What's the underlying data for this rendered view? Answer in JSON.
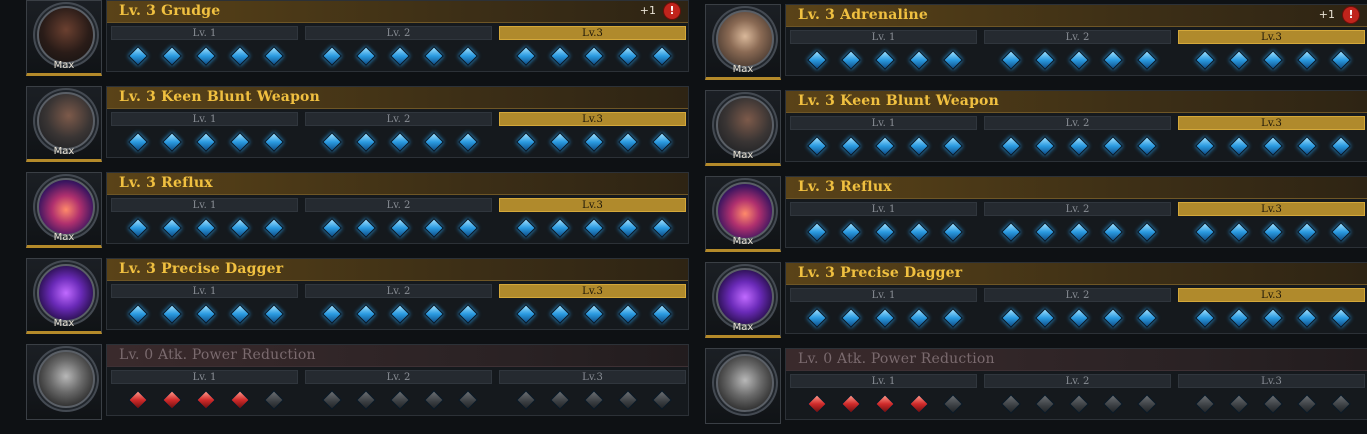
{
  "columns": [
    {
      "engravings": [
        {
          "title": "Lv. 3 Grudge",
          "orb": "grudge",
          "max": "Max",
          "plus": "+1",
          "alert": "!",
          "dim": false,
          "levels": [
            {
              "label": "Lv. 1",
              "active": false,
              "nodes": [
                "blue",
                "blue",
                "blue",
                "blue",
                "blue"
              ]
            },
            {
              "label": "Lv. 2",
              "active": false,
              "nodes": [
                "blue",
                "blue",
                "blue",
                "blue",
                "blue"
              ]
            },
            {
              "label": "Lv.3",
              "active": true,
              "nodes": [
                "blue",
                "blue",
                "blue",
                "blue",
                "blue"
              ]
            }
          ]
        },
        {
          "title": "Lv. 3 Keen Blunt Weapon",
          "orb": "keen",
          "max": "Max",
          "plus": "",
          "alert": "",
          "dim": false,
          "levels": [
            {
              "label": "Lv. 1",
              "active": false,
              "nodes": [
                "blue",
                "blue",
                "blue",
                "blue",
                "blue"
              ]
            },
            {
              "label": "Lv. 2",
              "active": false,
              "nodes": [
                "blue",
                "blue",
                "blue",
                "blue",
                "blue"
              ]
            },
            {
              "label": "Lv.3",
              "active": true,
              "nodes": [
                "blue",
                "blue",
                "blue",
                "blue",
                "blue"
              ]
            }
          ]
        },
        {
          "title": "Lv. 3 Reflux",
          "orb": "reflux",
          "max": "Max",
          "plus": "",
          "alert": "",
          "dim": false,
          "levels": [
            {
              "label": "Lv. 1",
              "active": false,
              "nodes": [
                "blue",
                "blue",
                "blue",
                "blue",
                "blue"
              ]
            },
            {
              "label": "Lv. 2",
              "active": false,
              "nodes": [
                "blue",
                "blue",
                "blue",
                "blue",
                "blue"
              ]
            },
            {
              "label": "Lv.3",
              "active": true,
              "nodes": [
                "blue",
                "blue",
                "blue",
                "blue",
                "blue"
              ]
            }
          ]
        },
        {
          "title": "Lv. 3 Precise Dagger",
          "orb": "dagger",
          "max": "Max",
          "plus": "",
          "alert": "",
          "dim": false,
          "levels": [
            {
              "label": "Lv. 1",
              "active": false,
              "nodes": [
                "blue",
                "blue",
                "blue",
                "blue",
                "blue"
              ]
            },
            {
              "label": "Lv. 2",
              "active": false,
              "nodes": [
                "blue",
                "blue",
                "blue",
                "blue",
                "blue"
              ]
            },
            {
              "label": "Lv.3",
              "active": true,
              "nodes": [
                "blue",
                "blue",
                "blue",
                "blue",
                "blue"
              ]
            }
          ]
        },
        {
          "title": "Lv. 0 Atk. Power Reduction",
          "orb": "atk",
          "max": "",
          "plus": "",
          "alert": "",
          "dim": true,
          "levels": [
            {
              "label": "Lv. 1",
              "active": false,
              "nodes": [
                "red",
                "red",
                "red",
                "red",
                "grey"
              ]
            },
            {
              "label": "Lv. 2",
              "active": false,
              "nodes": [
                "grey",
                "grey",
                "grey",
                "grey",
                "grey"
              ]
            },
            {
              "label": "Lv.3",
              "active": false,
              "nodes": [
                "grey",
                "grey",
                "grey",
                "grey",
                "grey"
              ]
            }
          ]
        }
      ]
    },
    {
      "engravings": [
        {
          "title": "Lv. 3 Adrenaline",
          "orb": "adren",
          "max": "Max",
          "plus": "+1",
          "alert": "!",
          "dim": false,
          "levels": [
            {
              "label": "Lv. 1",
              "active": false,
              "nodes": [
                "blue",
                "blue",
                "blue",
                "blue",
                "blue"
              ]
            },
            {
              "label": "Lv. 2",
              "active": false,
              "nodes": [
                "blue",
                "blue",
                "blue",
                "blue",
                "blue"
              ]
            },
            {
              "label": "Lv.3",
              "active": true,
              "nodes": [
                "blue",
                "blue",
                "blue",
                "blue",
                "blue"
              ]
            }
          ]
        },
        {
          "title": "Lv. 3 Keen Blunt Weapon",
          "orb": "keen",
          "max": "Max",
          "plus": "",
          "alert": "",
          "dim": false,
          "levels": [
            {
              "label": "Lv. 1",
              "active": false,
              "nodes": [
                "blue",
                "blue",
                "blue",
                "blue",
                "blue"
              ]
            },
            {
              "label": "Lv. 2",
              "active": false,
              "nodes": [
                "blue",
                "blue",
                "blue",
                "blue",
                "blue"
              ]
            },
            {
              "label": "Lv.3",
              "active": true,
              "nodes": [
                "blue",
                "blue",
                "blue",
                "blue",
                "blue"
              ]
            }
          ]
        },
        {
          "title": "Lv. 3 Reflux",
          "orb": "reflux",
          "max": "Max",
          "plus": "",
          "alert": "",
          "dim": false,
          "levels": [
            {
              "label": "Lv. 1",
              "active": false,
              "nodes": [
                "blue",
                "blue",
                "blue",
                "blue",
                "blue"
              ]
            },
            {
              "label": "Lv. 2",
              "active": false,
              "nodes": [
                "blue",
                "blue",
                "blue",
                "blue",
                "blue"
              ]
            },
            {
              "label": "Lv.3",
              "active": true,
              "nodes": [
                "blue",
                "blue",
                "blue",
                "blue",
                "blue"
              ]
            }
          ]
        },
        {
          "title": "Lv. 3 Precise Dagger",
          "orb": "dagger",
          "max": "Max",
          "plus": "",
          "alert": "",
          "dim": false,
          "levels": [
            {
              "label": "Lv. 1",
              "active": false,
              "nodes": [
                "blue",
                "blue",
                "blue",
                "blue",
                "blue"
              ]
            },
            {
              "label": "Lv. 2",
              "active": false,
              "nodes": [
                "blue",
                "blue",
                "blue",
                "blue",
                "blue"
              ]
            },
            {
              "label": "Lv.3",
              "active": true,
              "nodes": [
                "blue",
                "blue",
                "blue",
                "blue",
                "blue"
              ]
            }
          ]
        },
        {
          "title": "Lv. 0 Atk. Power Reduction",
          "orb": "atk",
          "max": "",
          "plus": "",
          "alert": "",
          "dim": true,
          "levels": [
            {
              "label": "Lv. 1",
              "active": false,
              "nodes": [
                "red",
                "red",
                "red",
                "red",
                "grey"
              ]
            },
            {
              "label": "Lv. 2",
              "active": false,
              "nodes": [
                "grey",
                "grey",
                "grey",
                "grey",
                "grey"
              ]
            },
            {
              "label": "Lv.3",
              "active": false,
              "nodes": [
                "grey",
                "grey",
                "grey",
                "grey",
                "grey"
              ]
            }
          ]
        }
      ]
    }
  ]
}
